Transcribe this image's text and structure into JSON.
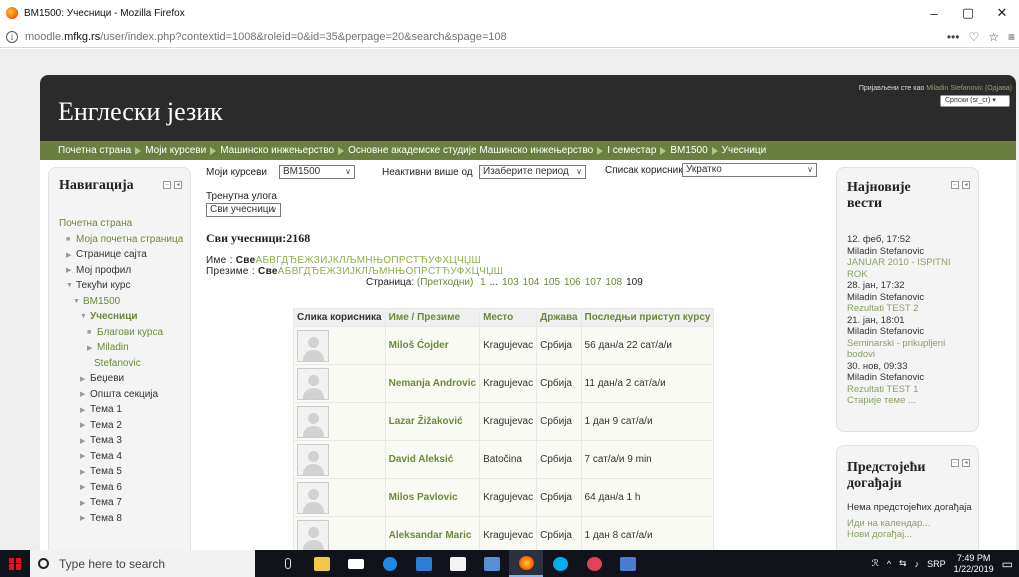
{
  "window": {
    "title": "BM1500: Учесници - Mozilla Firefox",
    "controls": [
      "–",
      "▢",
      "✕"
    ]
  },
  "urlbar": {
    "prefix": "moodle.",
    "domain": "mfkg.rs",
    "path": "/user/index.php?contextid=1008&roleid=0&id=35&perpage=20&search&spage=108",
    "right_icons": [
      "•••",
      "♡",
      "☆"
    ]
  },
  "header": {
    "site_title": "Енглески језик",
    "login_prefix": "Пријављени сте као ",
    "login_user": "Miladin Stefanovic",
    "logout": "(Одјава)",
    "language": "Српски (sr_cr)"
  },
  "breadcrumb": [
    "Почетна страна",
    "Моји курсеви",
    "Машинско инжењерство",
    "Основне академске студије Машинско инжењерство",
    "I семестар",
    "BM1500",
    "Учесници"
  ],
  "navigation": {
    "title": "Навигација",
    "items": [
      {
        "label": "Почетна страна",
        "marker": "",
        "indent": 0,
        "dark": false
      },
      {
        "label": "Моја почетна страница",
        "marker": "■",
        "indent": 1,
        "dark": false
      },
      {
        "label": "Странице сајта",
        "marker": "▶",
        "indent": 1,
        "dark": true
      },
      {
        "label": "Мој профил",
        "marker": "▶",
        "indent": 1,
        "dark": true
      },
      {
        "label": "Текући курс",
        "marker": "▼",
        "indent": 1,
        "dark": true
      },
      {
        "label": "BM1500",
        "marker": "▼",
        "indent": 2,
        "dark": false
      },
      {
        "label": "Учесници",
        "marker": "▼",
        "indent": 3,
        "dark": false,
        "bold": true
      },
      {
        "label": "Благови курса",
        "marker": "■",
        "indent": 4,
        "dark": false
      },
      {
        "label": "Miladin",
        "marker": "▶",
        "indent": 4,
        "dark": false
      },
      {
        "label": "Stefanovic",
        "marker": "",
        "indent": 5,
        "dark": false
      },
      {
        "label": "Беџеви",
        "marker": "▶",
        "indent": 3,
        "dark": true
      },
      {
        "label": "Општа секција",
        "marker": "▶",
        "indent": 3,
        "dark": true
      },
      {
        "label": "Тема 1",
        "marker": "▶",
        "indent": 3,
        "dark": true
      },
      {
        "label": "Тема 2",
        "marker": "▶",
        "indent": 3,
        "dark": true
      },
      {
        "label": "Тема 3",
        "marker": "▶",
        "indent": 3,
        "dark": true
      },
      {
        "label": "Тема 4",
        "marker": "▶",
        "indent": 3,
        "dark": true
      },
      {
        "label": "Тема 5",
        "marker": "▶",
        "indent": 3,
        "dark": true
      },
      {
        "label": "Тема 6",
        "marker": "▶",
        "indent": 3,
        "dark": true
      },
      {
        "label": "Тема 7",
        "marker": "▶",
        "indent": 3,
        "dark": true
      },
      {
        "label": "Тема 8",
        "marker": "▶",
        "indent": 3,
        "dark": true
      }
    ]
  },
  "filters": {
    "my_courses_label": "Моји курсеви",
    "my_courses_value": "BM1500",
    "inactive_label": "Неактивни више од",
    "inactive_value": "Изаберите период",
    "list_label": "Списак корисника",
    "list_value": "Укратко",
    "role_label": "Тренутна улога",
    "role_value": "Сви учесници"
  },
  "participants_heading": "Сви учесници:2168",
  "first_name_label": "Име : ",
  "last_name_label": "Презиме : ",
  "all_label": "Све",
  "letters": "АБВГДЂЕЖЗИЈКЛЉМНЊОПРСТЋУФХЦЧЏШ",
  "pagination": {
    "label": "Страница: ",
    "prev": "(Претходни)",
    "pages": [
      "1",
      "...",
      "103",
      "104",
      "105",
      "106",
      "107",
      "108"
    ],
    "current": "109"
  },
  "table": {
    "headers": {
      "photo": "Слика корисника",
      "name": "Име / Презиме",
      "city": "Место",
      "country": "Држава",
      "last_access": "Последњи приступ курсу"
    },
    "rows": [
      {
        "name": "Miloš Ćojder",
        "city": "Kragujevac",
        "country": "Србија",
        "last_access": "56 дан/а 22 сат/а/и"
      },
      {
        "name": "Nemanja Androvic",
        "city": "Kragujevac",
        "country": "Србија",
        "last_access": "11 дан/а 2 сат/а/и"
      },
      {
        "name": "Lazar Žižaković",
        "city": "Kragujevac",
        "country": "Србија",
        "last_access": "1 дан 9 сат/а/и"
      },
      {
        "name": "David Aleksić",
        "city": "Batočina",
        "country": "Србија",
        "last_access": "7 сат/а/и 9 min"
      },
      {
        "name": "Milos Pavlovic",
        "city": "Kragujevac",
        "country": "Србија",
        "last_access": "64 дан/а 1 h"
      },
      {
        "name": "Aleksandar Maric",
        "city": "Kragujevac",
        "country": "Србија",
        "last_access": "1 дан 8 сат/а/и"
      }
    ]
  },
  "news": {
    "title": "Најновије вести",
    "items": [
      {
        "date": "12. феб, 17:52",
        "author": "Miladin Stefanovic",
        "link": "JANUAR 2010 - ISPITNI ROK"
      },
      {
        "date": "28. јан, 17:32",
        "author": "Miladin Stefanovic",
        "link": "Rezultati TEST 2"
      },
      {
        "date": "21. јан, 18:01",
        "author": "Miladin Stefanovic",
        "link": "Seminarski - prikupljeni bodovi"
      },
      {
        "date": "30. нов, 09:33",
        "author": "Miladin Stefanovic",
        "link": "Rezultati TEST 1"
      }
    ],
    "older": "Старије теме ..."
  },
  "events": {
    "title": "Предстојећи догађаји",
    "none": "Нема предстојећих догађаја",
    "calendar": "Иди на календар...",
    "new_event": "Нови догађај..."
  },
  "taskbar": {
    "search_placeholder": "Type here to search",
    "time": "7:49 PM",
    "date": "1/22/2019",
    "lang": "SRP",
    "accent": "#e81123"
  }
}
